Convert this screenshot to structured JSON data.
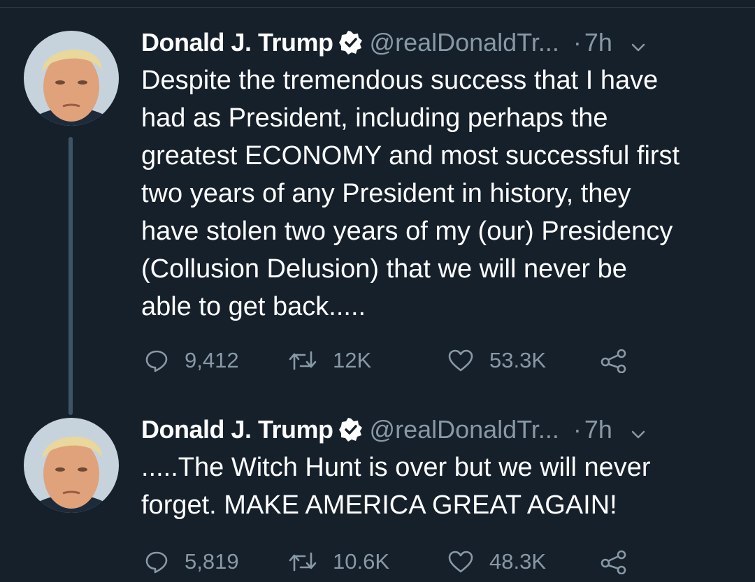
{
  "colors": {
    "background": "#15202b",
    "text": "#ffffff",
    "secondary": "#8899a6",
    "thread_line": "#3d5466"
  },
  "tweets": [
    {
      "name": "Donald J. Trump",
      "verified": true,
      "handle": "@realDonaldTr...",
      "separator": "·",
      "time": "7h",
      "text_lines": [
        "Despite the tremendous success that I have",
        "had as President, including perhaps the",
        "greatest ECONOMY and most successful first",
        "two years of any President in history, they",
        "have stolen two years of my (our) Presidency",
        "(Collusion Delusion) that we will never be",
        "able to get back....."
      ],
      "replies": "9,412",
      "retweets": "12K",
      "likes": "53.3K",
      "icons": [
        "reply-icon",
        "retweet-icon",
        "like-icon",
        "share-icon"
      ]
    },
    {
      "name": "Donald J. Trump",
      "verified": true,
      "handle": "@realDonaldTr...",
      "separator": "·",
      "time": "7h",
      "text_lines": [
        ".....The Witch Hunt is over but we will never",
        "forget. MAKE AMERICA GREAT AGAIN!"
      ],
      "replies": "5,819",
      "retweets": "10.6K",
      "likes": "48.3K",
      "icons": [
        "reply-icon",
        "retweet-icon",
        "like-icon",
        "share-icon"
      ]
    }
  ]
}
